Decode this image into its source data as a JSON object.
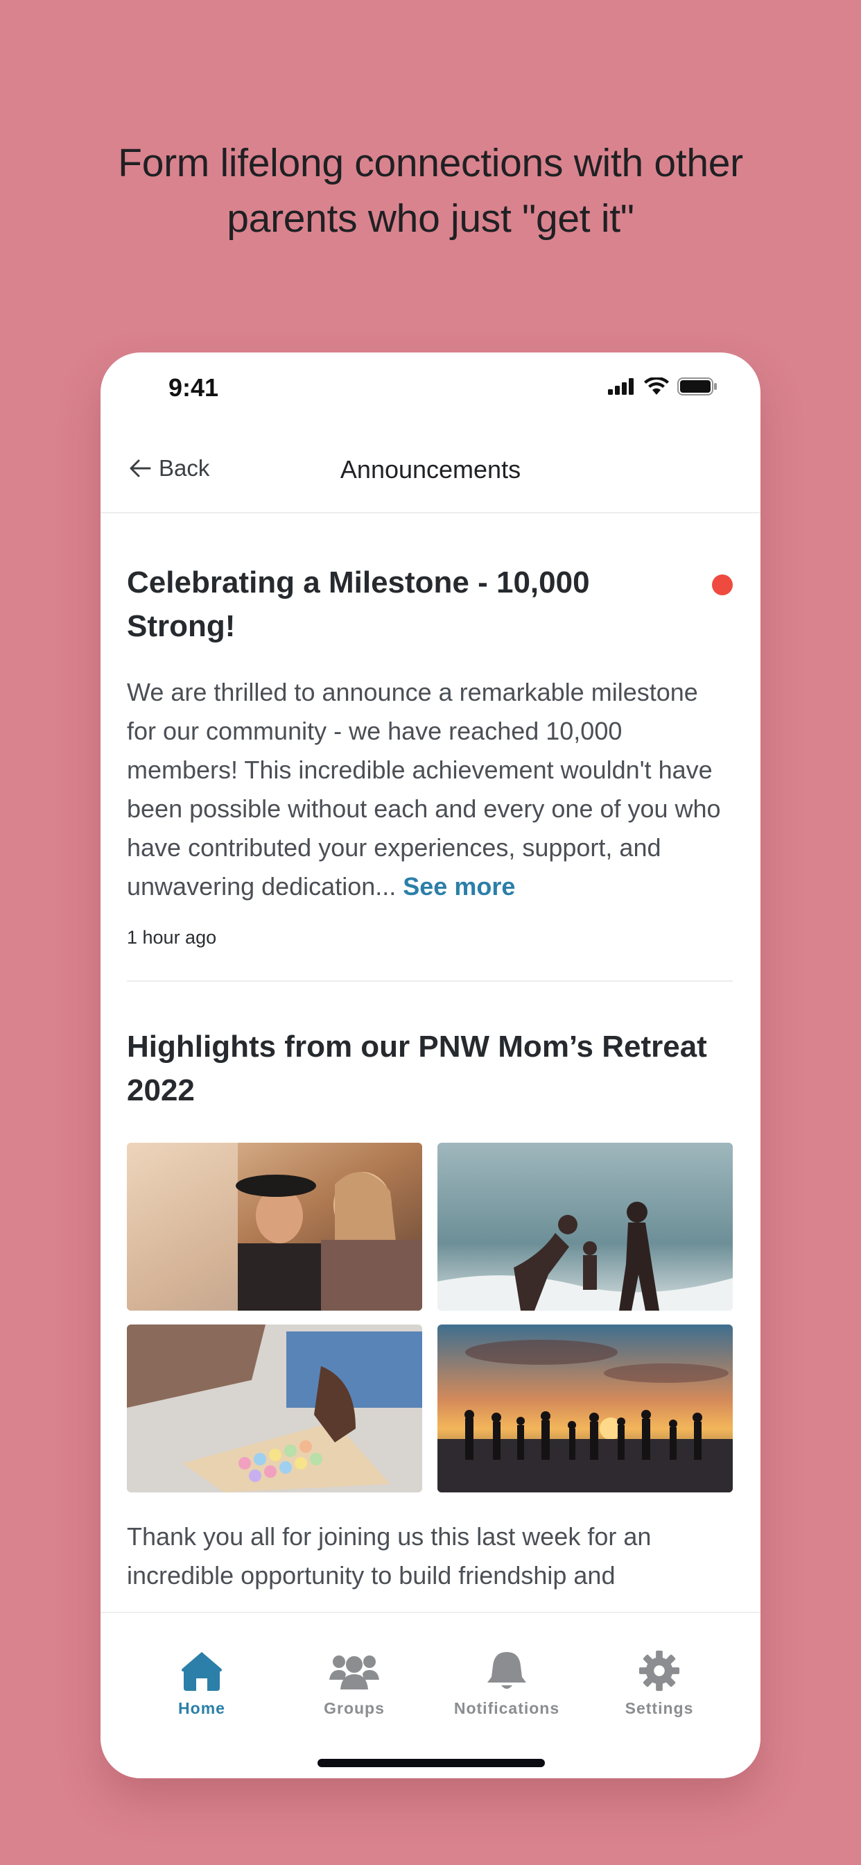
{
  "headline": {
    "line1": "Form lifelong connections with other",
    "line2": "parents who just \"get it\""
  },
  "status_bar": {
    "time": "9:41",
    "icons": [
      "signal-icon",
      "wifi-icon",
      "battery-icon"
    ]
  },
  "nav": {
    "back_label": "Back",
    "title": "Announcements"
  },
  "posts": [
    {
      "title": "Celebrating a Milestone - 10,000 Strong!",
      "body": "We are thrilled to announce a remarkable milestone for our community - we have reached 10,000 members! This incredible achievement wouldn't have been possible without each and every one of you who have contributed your experiences, support, and unwavering dedication...",
      "see_more": "See more",
      "time": "1 hour ago",
      "unread": true
    },
    {
      "title": "Highlights from our PNW Mom’s Retreat 2022",
      "images": [
        "women-laughing-photo",
        "beach-family-photo",
        "sidewalk-chalk-photo",
        "sunset-group-photo"
      ],
      "body": "Thank you all for joining us this last week for an incredible opportunity to build friendship and"
    }
  ],
  "tabbar": {
    "tabs": [
      {
        "label": "Home",
        "icon": "home-icon",
        "active": true
      },
      {
        "label": "Groups",
        "icon": "groups-icon",
        "active": false
      },
      {
        "label": "Notifications",
        "icon": "bell-icon",
        "active": false
      },
      {
        "label": "Settings",
        "icon": "gear-icon",
        "active": false
      }
    ]
  },
  "colors": {
    "background": "#d9838e",
    "accent": "#2b7fa8",
    "unread_dot": "#ef4a3f",
    "inactive_tab": "#8b8d90"
  }
}
